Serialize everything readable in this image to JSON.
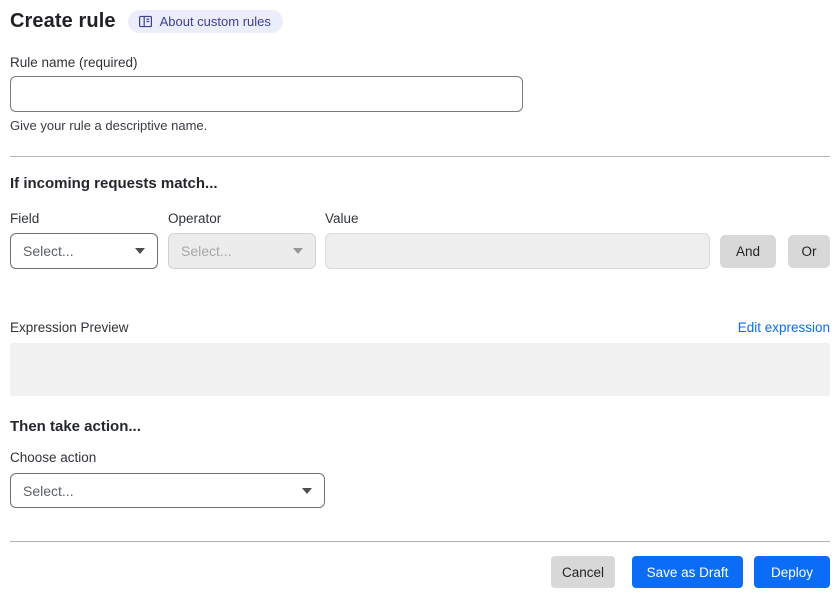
{
  "page": {
    "title": "Create rule",
    "about_link_label": "About custom rules"
  },
  "rule_name": {
    "label": "Rule name (required)",
    "value": "",
    "helper": "Give your rule a descriptive name."
  },
  "match_section": {
    "heading": "If incoming requests match...",
    "field": {
      "label": "Field",
      "selected": "Select...",
      "disabled": false
    },
    "operator": {
      "label": "Operator",
      "selected": "Select...",
      "disabled": true
    },
    "value": {
      "label": "Value",
      "value": "",
      "disabled": true
    },
    "and_button_label": "And",
    "or_button_label": "Or",
    "expression_preview_label": "Expression Preview",
    "edit_expression_link": "Edit expression",
    "expression_preview_value": ""
  },
  "action_section": {
    "heading": "Then take action...",
    "choose_action_label": "Choose action",
    "action_select": {
      "selected": "Select...",
      "disabled": false
    }
  },
  "footer": {
    "cancel_label": "Cancel",
    "save_draft_label": "Save as Draft",
    "deploy_label": "Deploy"
  },
  "colors": {
    "primary_blue": "#0b6cf5",
    "link_blue": "#0a6cf0",
    "badge_background": "#ebedfa",
    "badge_text": "#3c3f96",
    "disabled_background": "#ececec",
    "preview_background": "#f1f1f2",
    "secondary_button_gray": "#d8d8d8",
    "divider_gray": "#b7b7b7"
  }
}
